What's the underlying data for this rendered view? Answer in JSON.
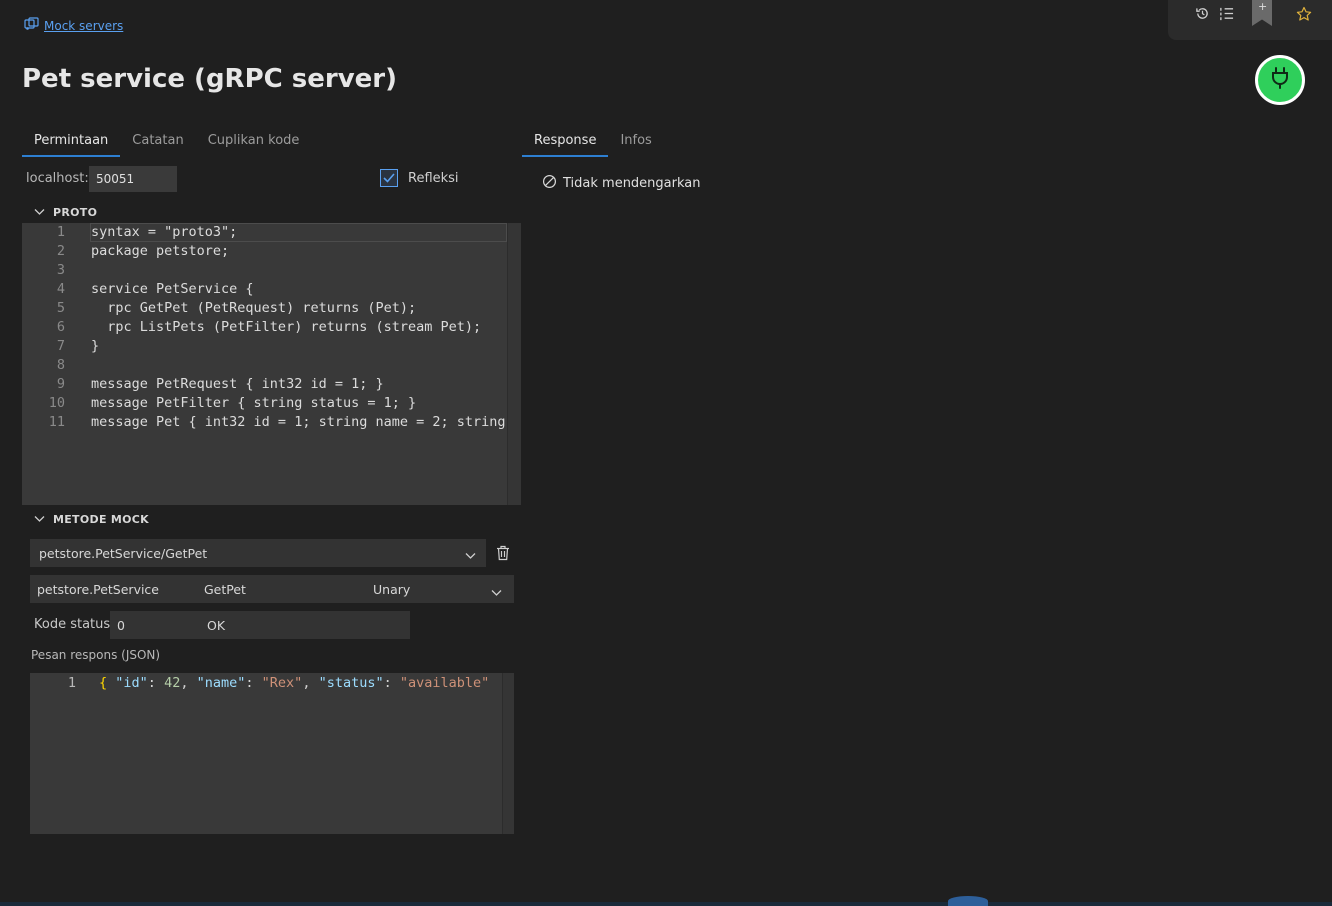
{
  "breadcrumb": {
    "label": "Mock servers"
  },
  "page": {
    "title": "Pet service (gRPC server)"
  },
  "left_tabs": [
    {
      "label": "Permintaan",
      "active": true
    },
    {
      "label": "Catatan",
      "active": false
    },
    {
      "label": "Cuplikan kode",
      "active": false
    }
  ],
  "right_tabs": [
    {
      "label": "Response",
      "active": true
    },
    {
      "label": "Infos",
      "active": false
    }
  ],
  "host": {
    "label": "localhost:",
    "port": "50051"
  },
  "reflection": {
    "label": "Refleksi",
    "checked": true
  },
  "proto": {
    "section_label": "PROTO",
    "lines": [
      "syntax = \"proto3\";",
      "package petstore;",
      "",
      "service PetService {",
      "  rpc GetPet (PetRequest) returns (Pet);",
      "  rpc ListPets (PetFilter) returns (stream Pet);",
      "}",
      "",
      "message PetRequest { int32 id = 1; }",
      "message PetFilter { string status = 1; }",
      "message Pet { int32 id = 1; string name = 2; string"
    ],
    "line_numbers": [
      "1",
      "2",
      "3",
      "4",
      "5",
      "6",
      "7",
      "8",
      "9",
      "10",
      "11"
    ]
  },
  "mock": {
    "section_label": "METODE MOCK",
    "method_select": "petstore.PetService/GetPet",
    "service": "petstore.PetService",
    "method": "GetPet",
    "call_type": "Unary",
    "status_label": "Kode status",
    "status_code": "0",
    "status_text": "OK",
    "response_label": "Pesan respons (JSON)",
    "response_line_number": "1",
    "response_json": "{ \"id\": 42, \"name\": \"Rex\", \"status\": \"available\""
  },
  "response_panel": {
    "status_text": "Tidak mendengarkan"
  },
  "icons": {
    "history": "history-icon",
    "list": "list-icon",
    "bookmark": "bookmark-add-icon",
    "star": "star-icon",
    "plug": "plug-icon"
  },
  "colors": {
    "accent": "#2d7fd2",
    "link": "#5aa0f0",
    "connect_button": "#2fcf5b",
    "star": "#e0b23c",
    "background": "#1f1f1f"
  }
}
